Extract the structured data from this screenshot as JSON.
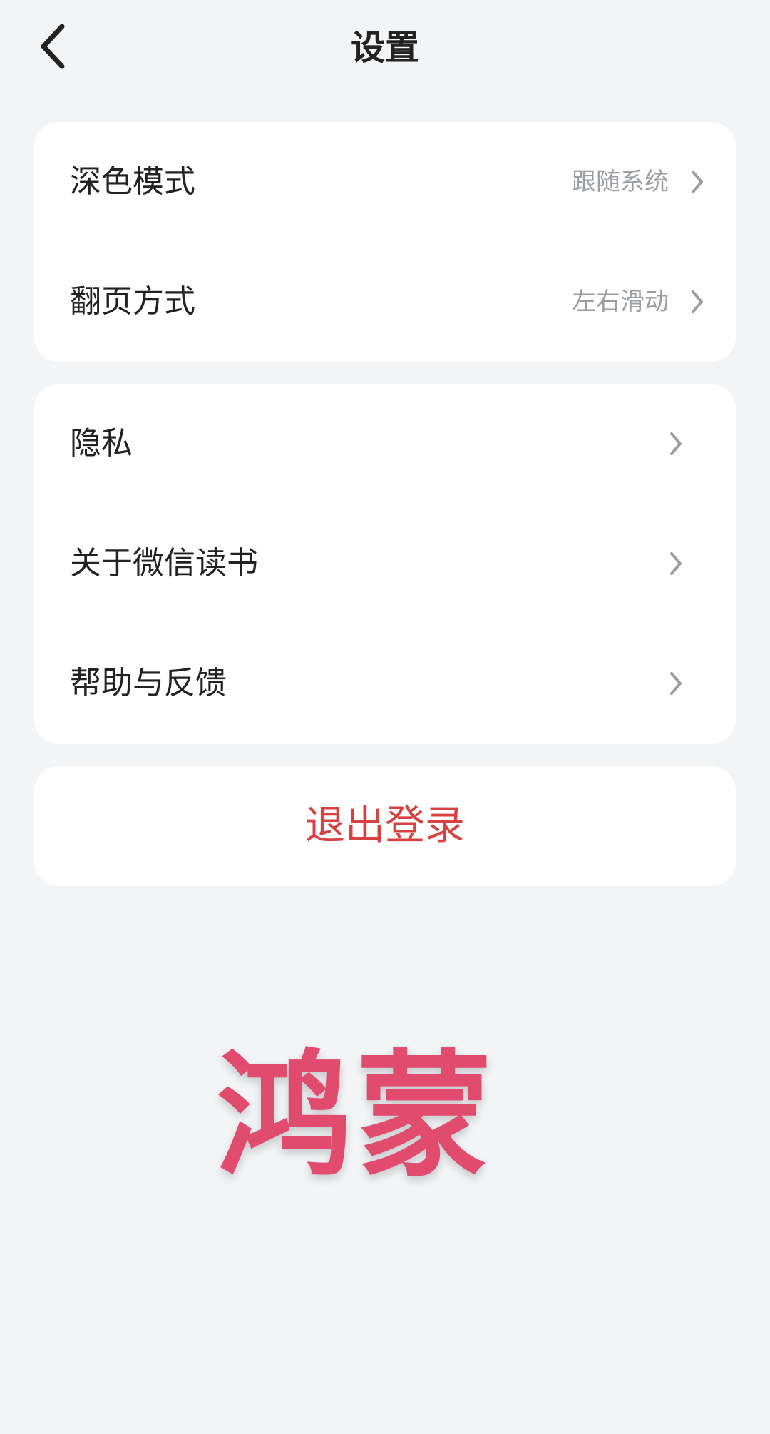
{
  "header": {
    "title": "设置",
    "back_icon": "chevron-left-icon"
  },
  "display_section": {
    "items": [
      {
        "label": "深色模式",
        "value": "跟随系统"
      },
      {
        "label": "翻页方式",
        "value": "左右滑动"
      }
    ]
  },
  "info_section": {
    "items": [
      {
        "label": "隐私"
      },
      {
        "label": "关于微信读书"
      },
      {
        "label": "帮助与反馈"
      }
    ]
  },
  "logout": {
    "label": "退出登录",
    "color": "#d8413f"
  },
  "watermark": {
    "text": "鸿蒙",
    "color": "#e04b6e"
  },
  "colors": {
    "background": "#f2f4f6",
    "card": "#ffffff",
    "secondary_text": "#9a9da2"
  }
}
